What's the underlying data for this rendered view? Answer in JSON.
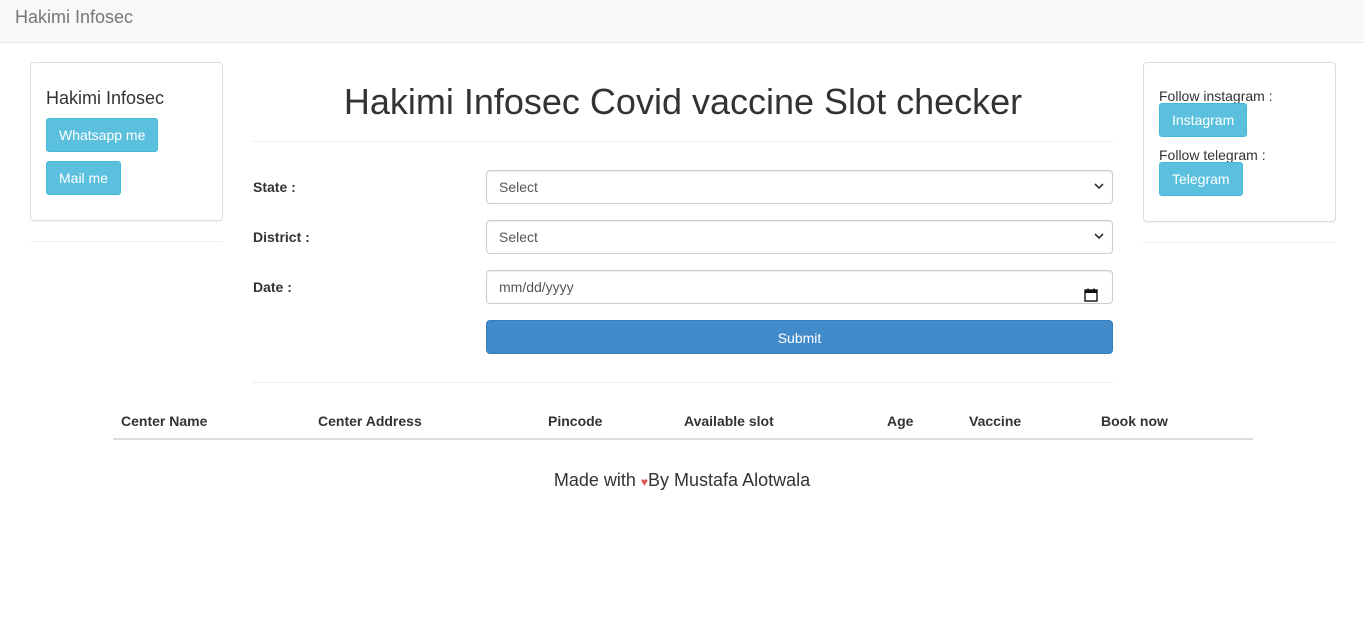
{
  "navbar": {
    "brand": "Hakimi Infosec"
  },
  "left_panel": {
    "title": "Hakimi Infosec",
    "whatsapp_label": "Whatsapp me",
    "mail_label": "Mail me"
  },
  "right_panel": {
    "instagram_text": "Follow instagram :",
    "instagram_label": "Instagram",
    "telegram_text": "Follow telegram :",
    "telegram_label": "Telegram"
  },
  "main": {
    "title": "Hakimi Infosec Covid vaccine Slot checker",
    "form": {
      "state_label": "State :",
      "state_value": "Select",
      "district_label": "District :",
      "district_value": "Select",
      "date_label": "Date :",
      "date_placeholder": "mm/dd/yyyy",
      "submit_label": "Submit"
    }
  },
  "table": {
    "headers": [
      "Center Name",
      "Center Address",
      "Pincode",
      "Available slot",
      "Age",
      "Vaccine",
      "Book now"
    ],
    "rows": []
  },
  "footer": {
    "prefix": "Made with ",
    "heart": "♥",
    "suffix": "By Mustafa Alotwala"
  },
  "colors": {
    "info": "#5bc0de",
    "primary": "#428bca",
    "heart": "#e25555"
  },
  "icons": {
    "select_arrow": "chevron-down-icon",
    "date_picker": "calendar-icon",
    "footer_heart": "heart-icon"
  }
}
